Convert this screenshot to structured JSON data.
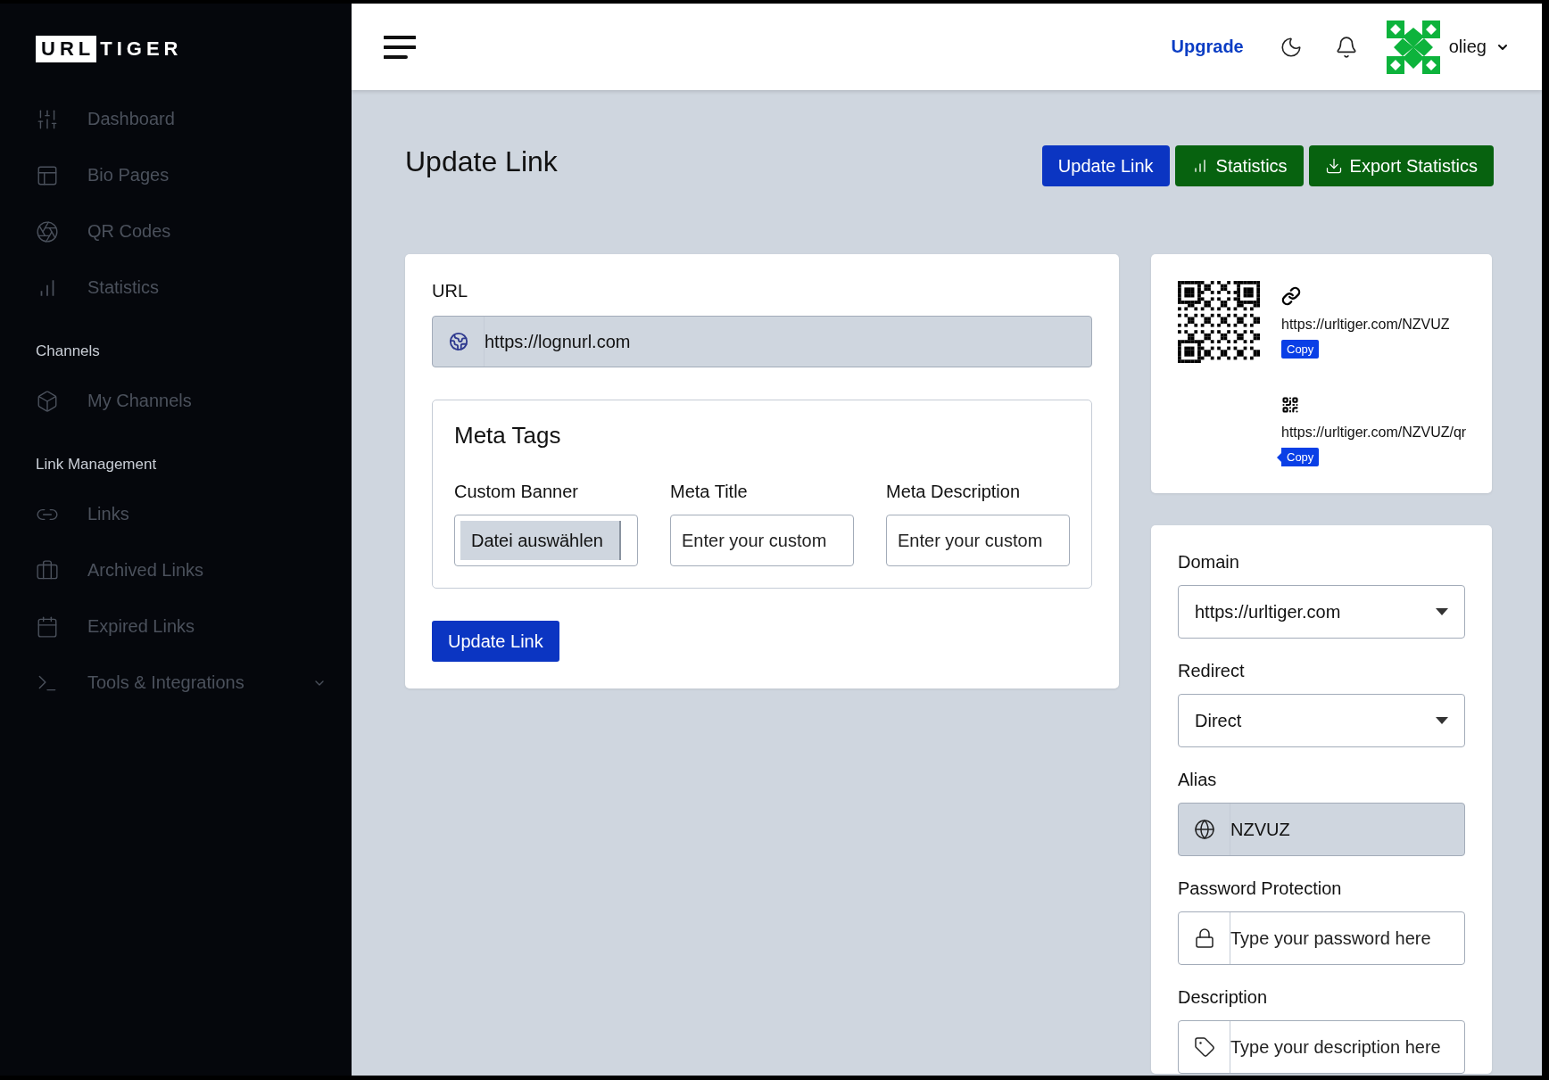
{
  "logo": {
    "boxed": "URL",
    "rest": "TIGER"
  },
  "sidebar": {
    "sections": [
      {
        "items": [
          {
            "label": "Dashboard"
          },
          {
            "label": "Bio Pages"
          },
          {
            "label": "QR Codes"
          },
          {
            "label": "Statistics"
          }
        ]
      },
      {
        "heading": "Channels",
        "items": [
          {
            "label": "My Channels"
          }
        ]
      },
      {
        "heading": "Link Management",
        "items": [
          {
            "label": "Links"
          },
          {
            "label": "Archived Links"
          },
          {
            "label": "Expired Links"
          },
          {
            "label": "Tools & Integrations",
            "expanded": false
          }
        ]
      }
    ]
  },
  "header": {
    "upgrade": "Upgrade",
    "user": "olieg"
  },
  "page": {
    "title": "Update Link",
    "actions": [
      {
        "label": "Update Link",
        "kind": "primary"
      },
      {
        "label": "Statistics",
        "kind": "stats"
      },
      {
        "label": "Export Statistics",
        "kind": "export"
      }
    ]
  },
  "url_field": {
    "label": "URL",
    "value": "https://lognurl.com"
  },
  "meta_tags": {
    "title": "Meta Tags",
    "fields": [
      {
        "label": "Custom Banner",
        "kind": "file",
        "button": "Datei auswählen"
      },
      {
        "label": "Meta Title",
        "kind": "text",
        "placeholder": "Enter your custom"
      },
      {
        "label": "Meta Description",
        "kind": "text",
        "placeholder": "Enter your custom"
      }
    ]
  },
  "submit": "Update Link",
  "share": {
    "links": [
      {
        "kind": "link",
        "url": "https://urltiger.com/NZVUZ",
        "copy": "Copy"
      },
      {
        "kind": "qr",
        "url": "https://urltiger.com/NZVUZ/qr",
        "copy": "Copy"
      }
    ]
  },
  "settings": {
    "fields": [
      {
        "label": "Domain",
        "kind": "select",
        "value": "https://urltiger.com"
      },
      {
        "label": "Redirect",
        "kind": "select",
        "value": "Direct"
      },
      {
        "label": "Alias",
        "kind": "alias",
        "value": "NZVUZ"
      },
      {
        "label": "Password Protection",
        "kind": "password",
        "placeholder": "Type your password here"
      },
      {
        "label": "Description",
        "kind": "description",
        "placeholder": "Type your description here"
      }
    ]
  }
}
